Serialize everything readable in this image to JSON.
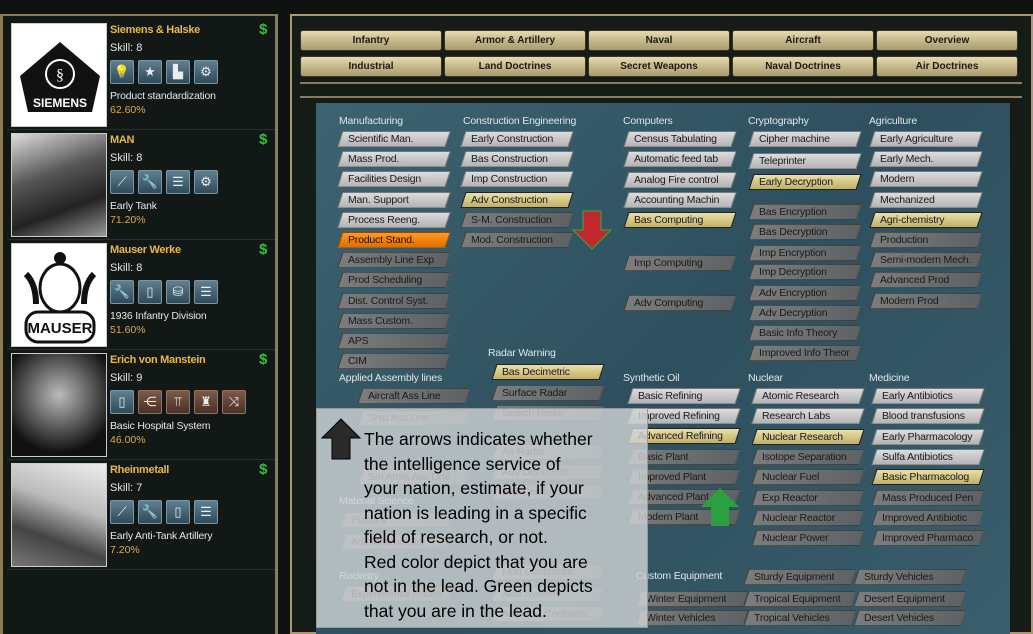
{
  "tabs": {
    "row1": [
      "Infantry",
      "Armor & Artillery",
      "Naval",
      "Aircraft",
      "Overview"
    ],
    "row2": [
      "Industrial",
      "Land Doctrines",
      "Secret Weapons",
      "Naval Doctrines",
      "Air Doctrines"
    ]
  },
  "companies": [
    {
      "name": "Siemens & Halske",
      "skill": "Skill: 8",
      "icons": [
        "lightbulb-icon",
        "star-icon",
        "factory-icon",
        "gears-icon"
      ],
      "tech": "Product standardization",
      "progress": "62.60%",
      "logo": "SIEMENS",
      "funded": "$"
    },
    {
      "name": "MAN",
      "skill": "Skill: 8",
      "icons": [
        "tank-gun-icon",
        "wrench-icon",
        "bar-chart-icon",
        "tank-icon"
      ],
      "tech": "Early Tank",
      "progress": "71.20%",
      "funded": "$"
    },
    {
      "name": "Mauser Werke",
      "skill": "Skill: 8",
      "icons": [
        "wrench-icon",
        "book-icon",
        "database-icon",
        "bar-chart-icon"
      ],
      "tech": "1936 Infantry Division",
      "progress": "51.60%",
      "logo": "MAUSER",
      "funded": "$"
    },
    {
      "name": "Erich von Manstein",
      "skill": "Skill: 9",
      "icons": [
        "book-icon",
        "organization-icon",
        "hierarchy-icon",
        "soldiers-icon",
        "crossed-arrows-icon"
      ],
      "tech": "Basic Hospital System",
      "progress": "46.00%",
      "funded": "$"
    },
    {
      "name": "Rheinmetall",
      "skill": "Skill: 7",
      "icons": [
        "tank-gun-icon",
        "wrench-icon",
        "book-icon",
        "bar-chart-icon"
      ],
      "tech": "Early Anti-Tank Artillery",
      "progress": "7.20%",
      "funded": "$"
    }
  ],
  "research": {
    "groups": [
      {
        "id": "manufacturing",
        "title": "Manufacturing",
        "items": [
          {
            "label": "Scientific Man.",
            "state": "light"
          },
          {
            "label": "Mass Prod.",
            "state": "light"
          },
          {
            "label": "Facilities Design",
            "state": "light"
          },
          {
            "label": "Man. Support",
            "state": "light"
          },
          {
            "label": "Process Reeng.",
            "state": "light"
          },
          {
            "label": "Product Stand.",
            "state": "orange"
          },
          {
            "label": "Assembly Line Exp",
            "state": "dark"
          },
          {
            "label": "Prod Scheduling",
            "state": "dark"
          },
          {
            "label": "Dist. Control Syst.",
            "state": "dark"
          },
          {
            "label": "Mass Custom.",
            "state": "dark"
          },
          {
            "label": "APS",
            "state": "dark"
          },
          {
            "label": "CIM",
            "state": "dark"
          }
        ]
      },
      {
        "id": "construction",
        "title": "Construction Engineering",
        "items": [
          {
            "label": "Early Construction",
            "state": "light"
          },
          {
            "label": "Bas Construction",
            "state": "light"
          },
          {
            "label": "Imp Construction",
            "state": "light"
          },
          {
            "label": "Adv Construction",
            "state": "gold"
          },
          {
            "label": "S-M. Construction",
            "state": "dark"
          },
          {
            "label": "Mod. Construction",
            "state": "dark"
          }
        ]
      },
      {
        "id": "computers",
        "title": "Computers",
        "items": [
          {
            "label": "Census Tabulating",
            "state": "light"
          },
          {
            "label": "Automatic feed tab",
            "state": "light"
          },
          {
            "label": "Analog Fire control",
            "state": "light"
          },
          {
            "label": "Accounting Machin",
            "state": "light"
          },
          {
            "label": "Bas Computing",
            "state": "gold"
          },
          {
            "label": "Imp Computing",
            "state": "dark"
          },
          {
            "label": "Adv Computing",
            "state": "dark"
          }
        ]
      },
      {
        "id": "cryptography",
        "title": "Cryptography",
        "items": [
          {
            "label": "Cipher machine",
            "state": "light"
          },
          {
            "label": "Teleprinter",
            "state": "light"
          },
          {
            "label": "Early Decryption",
            "state": "gold"
          },
          {
            "label": "Bas Encryption",
            "state": "dark"
          },
          {
            "label": "Bas Decryption",
            "state": "dark"
          },
          {
            "label": "Imp Encryption",
            "state": "dark"
          },
          {
            "label": "Imp Decryption",
            "state": "dark"
          },
          {
            "label": "Adv Encryption",
            "state": "dark"
          },
          {
            "label": "Adv Decryption",
            "state": "dark"
          },
          {
            "label": "Basic Info Theory",
            "state": "dark"
          },
          {
            "label": "Improved Info Theor",
            "state": "dark"
          }
        ]
      },
      {
        "id": "agriculture",
        "title": "Agriculture",
        "items": [
          {
            "label": "Early Agriculture",
            "state": "light"
          },
          {
            "label": "Early Mech.",
            "state": "light"
          },
          {
            "label": "Modern",
            "state": "light"
          },
          {
            "label": "Mechanized",
            "state": "light"
          },
          {
            "label": "Agri-chemistry",
            "state": "gold"
          },
          {
            "label": "Production",
            "state": "dark"
          },
          {
            "label": "Semi-modern Mech.",
            "state": "dark"
          },
          {
            "label": "Advanced Prod",
            "state": "dark"
          },
          {
            "label": "Modern Prod",
            "state": "dark"
          }
        ]
      },
      {
        "id": "assembly",
        "title": "Applied Assembly lines",
        "items": [
          {
            "label": "Aircraft Ass Line",
            "state": "dark"
          },
          {
            "label": "Ship Ass Line",
            "state": "dark"
          },
          {
            "label": "Sm Arms Ass Line",
            "state": "dark"
          }
        ]
      },
      {
        "id": "material",
        "title": "Material Science",
        "items": [
          {
            "label": "Plastics",
            "state": "dark"
          },
          {
            "label": "Adv Material Sci",
            "state": "dark"
          }
        ]
      },
      {
        "id": "rocketry",
        "title": "Rocketry",
        "items": [
          {
            "label": "Experimental Rocke",
            "state": "dark"
          }
        ]
      },
      {
        "id": "radar",
        "title": "Radar Warning",
        "items": [
          {
            "label": "Bas Decimetric",
            "state": "gold"
          },
          {
            "label": "Surface Radar",
            "state": "dark"
          },
          {
            "label": "Search Radar",
            "state": "dark"
          },
          {
            "label": "Air Radar",
            "state": "dark"
          },
          {
            "label": "Adv Decimetric",
            "state": "dark"
          },
          {
            "label": "Bas Centimetric",
            "state": "dark"
          },
          {
            "label": "Mod Centimetric",
            "state": "dark"
          },
          {
            "label": "Aids System",
            "state": "dark"
          },
          {
            "label": "Adv.Mod.Centimetr",
            "state": "dark"
          }
        ]
      },
      {
        "id": "synthetic",
        "title": "Synthetic Oil",
        "items": [
          {
            "label": "Basic Refining",
            "state": "light"
          },
          {
            "label": "Improved Refining",
            "state": "light"
          },
          {
            "label": "Advanced Refining",
            "state": "gold"
          },
          {
            "label": "Basic Plant",
            "state": "dark"
          },
          {
            "label": "Improved Plant",
            "state": "dark"
          },
          {
            "label": "Advanced Plant",
            "state": "dark"
          },
          {
            "label": "Modern Plant",
            "state": "dark"
          }
        ]
      },
      {
        "id": "nuclear",
        "title": "Nuclear",
        "items": [
          {
            "label": "Atomic Research",
            "state": "light"
          },
          {
            "label": "Research Labs",
            "state": "light"
          },
          {
            "label": "Nuclear Research",
            "state": "gold"
          },
          {
            "label": "Isotope Separation",
            "state": "dark"
          },
          {
            "label": "Nuclear Fuel",
            "state": "dark"
          },
          {
            "label": "Exp Reactor",
            "state": "dark"
          },
          {
            "label": "Nuclear Reactor",
            "state": "dark"
          },
          {
            "label": "Nuclear Power",
            "state": "dark"
          }
        ]
      },
      {
        "id": "medicine",
        "title": "Medicine",
        "items": [
          {
            "label": "Early Antibiotics",
            "state": "light"
          },
          {
            "label": "Blood transfusions",
            "state": "light"
          },
          {
            "label": "Early Pharmacology",
            "state": "light"
          },
          {
            "label": "Sulfa Antibiotics",
            "state": "light"
          },
          {
            "label": "Basic Pharmacolog",
            "state": "gold"
          },
          {
            "label": "Mass Produced Pen",
            "state": "dark"
          },
          {
            "label": "Improved Antibiotic",
            "state": "dark"
          },
          {
            "label": "Improved Pharmaco",
            "state": "dark"
          }
        ]
      },
      {
        "id": "custom",
        "title": "Custom Equipment",
        "items": [
          {
            "label": "Winter Equipment",
            "state": "dark"
          },
          {
            "label": "Winter Vehicles",
            "state": "dark"
          }
        ]
      },
      {
        "id": "custom2",
        "title": "",
        "items": [
          {
            "label": "Sturdy Equipment",
            "state": "dark"
          },
          {
            "label": "Tropical Equipment",
            "state": "dark"
          },
          {
            "label": "Tropical Vehicles",
            "state": "dark"
          }
        ]
      },
      {
        "id": "custom3",
        "title": "",
        "items": [
          {
            "label": "Sturdy Vehicles",
            "state": "dark"
          },
          {
            "label": "Desert Equipment",
            "state": "dark"
          },
          {
            "label": "Desert Vehicles",
            "state": "dark"
          }
        ]
      }
    ]
  },
  "arrows": [
    {
      "group": "construction",
      "direction": "down",
      "color": "#c0282c"
    },
    {
      "group": "synthetic",
      "direction": "up",
      "color": "#2aa040"
    }
  ],
  "tooltip": {
    "arrow_color": "#2a2a2a",
    "text": "The arrows indicates whether\nthe intelligence service of\nyour nation, estimate, if your\nnation is leading in a specific\nfield of research, or not.\n Red color depict that you are\nnot in the lead. Green depicts\nthat you are in the lead."
  }
}
